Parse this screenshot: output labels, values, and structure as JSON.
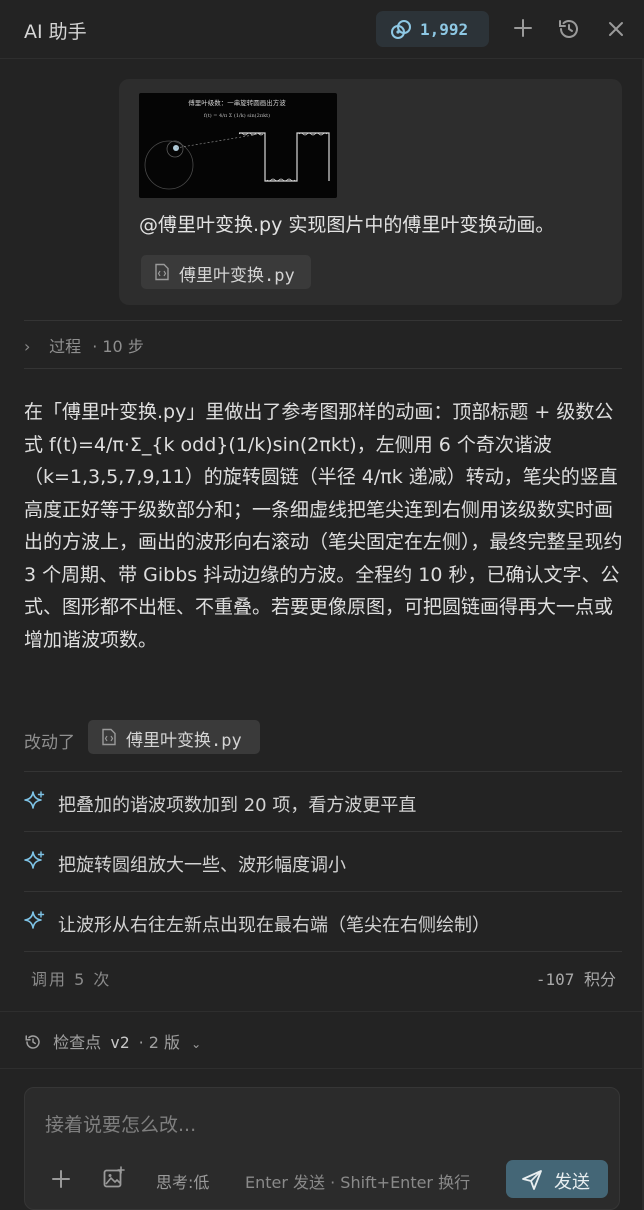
{
  "header": {
    "title": "AI 助手",
    "credits": "1,992",
    "icons": [
      "credits-icon",
      "plus-icon",
      "history-icon",
      "close-icon"
    ]
  },
  "user_message": {
    "thumbnail": {
      "title": "傅里叶级数：一串旋转圆画出方波",
      "formula": "f(t) = 4/π Σ (1/k) sin(2πkt)"
    },
    "text": "@傅里叶变换.py 实现图片中的傅里叶变换动画。",
    "file_chip": "傅里叶变换.py"
  },
  "process": {
    "label": "过程",
    "steps": "· 10 步"
  },
  "answer": {
    "text": "在「傅里叶变换.py」里做出了参考图那样的动画：顶部标题 + 级数公式 f(t)=4/π·Σ_{k odd}(1/k)sin(2πkt)，左侧用 6 个奇次谐波（k=1,3,5,7,9,11）的旋转圆链（半径 4/πk 递减）转动，笔尖的竖直高度正好等于级数部分和；一条细虚线把笔尖连到右侧用该级数实时画出的方波上，画出的波形向右滚动（笔尖固定在左侧），最终完整呈现约 3 个周期、带 Gibbs 抖动边缘的方波。全程约 10 秒，已确认文字、公式、图形都不出框、不重叠。若要更像原图，可把圆链画得再大一点或增加谐波项数。"
  },
  "changed": {
    "label": "改动了",
    "file": "傅里叶变换.py"
  },
  "suggestions": [
    {
      "label": "把叠加的谐波项数加到 20 项，看方波更平直"
    },
    {
      "label": "把旋转圆组放大一些、波形幅度调小"
    },
    {
      "label": "让波形从右往左新点出现在最右端（笔尖在右侧绘制）"
    }
  ],
  "stats": {
    "calls": "调用 5 次",
    "points": "-107 积分"
  },
  "checkpoint": {
    "label": "检查点",
    "version": "v2",
    "count": "· 2 版"
  },
  "composer": {
    "placeholder": "接着说要怎么改...",
    "think": "思考:低",
    "hint": "Enter 发送 · Shift+Enter 换行",
    "send_label": "发送"
  },
  "colors": {
    "background": "#232323",
    "accent": "#8ec8e4",
    "send_button": "#446676",
    "sparkle": "#7ec3e6"
  }
}
